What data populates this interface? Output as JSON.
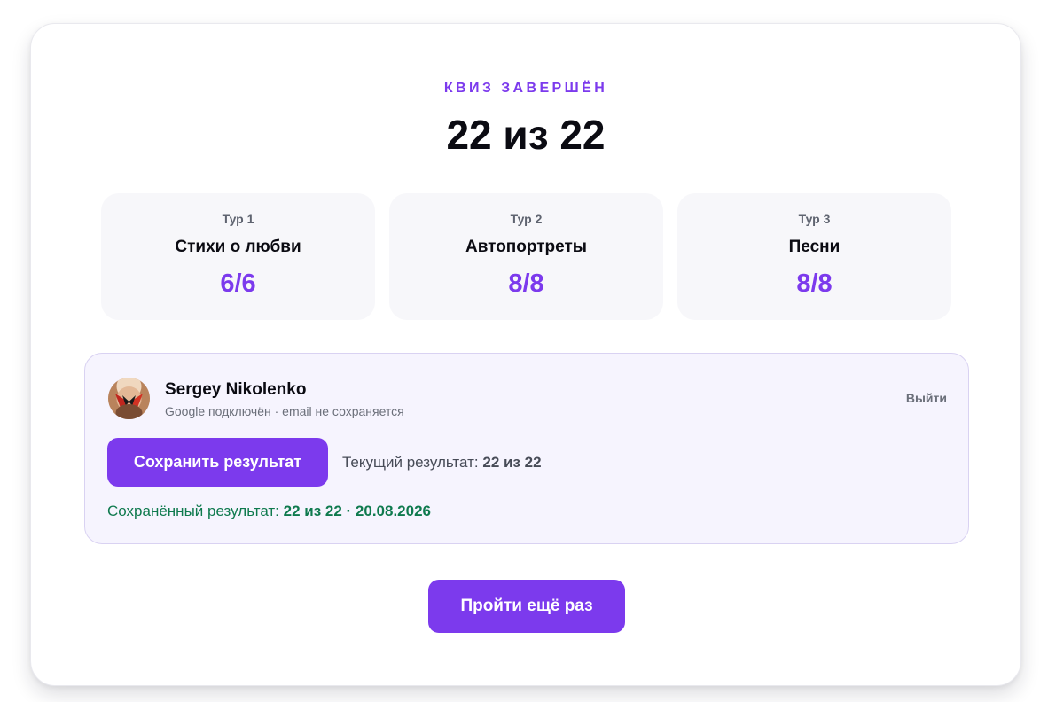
{
  "header": {
    "eyebrow": "КВИЗ ЗАВЕРШЁН",
    "score": "22 из 22"
  },
  "rounds": [
    {
      "label": "Тур 1",
      "name": "Стихи о любви",
      "score": "6/6"
    },
    {
      "label": "Тур 2",
      "name": "Автопортреты",
      "score": "8/8"
    },
    {
      "label": "Тур 3",
      "name": "Песни",
      "score": "8/8"
    }
  ],
  "account": {
    "user_name": "Sergey Nikolenko",
    "status": "Google подключён · email не сохраняется",
    "logout_label": "Выйти",
    "save_label": "Сохранить результат",
    "current_label": "Текущий результат:",
    "current_value": "22 из 22",
    "saved_label": "Сохранённый результат:",
    "saved_value": "22 из 22 · 20.08.2026"
  },
  "retry_label": "Пройти ещё раз",
  "colors": {
    "accent": "#7c3aed",
    "success": "#0f7a4e",
    "panel_bg": "#f6f4fe",
    "card_bg": "#f7f7fa"
  }
}
